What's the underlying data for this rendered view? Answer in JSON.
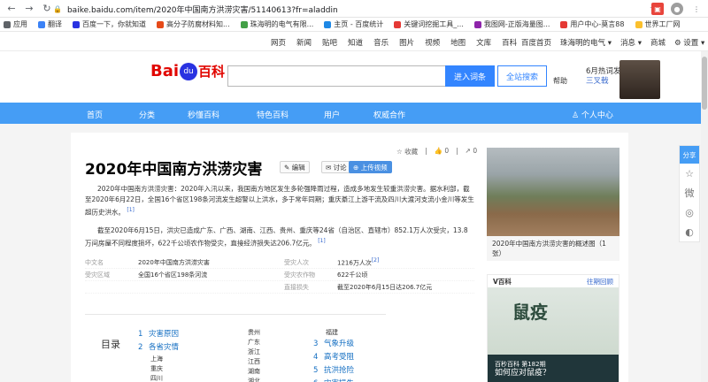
{
  "browser": {
    "url": "baike.baidu.com/item/2020年中国南方洪涝灾害/51140613?fr=aladdin",
    "back": "←",
    "forward": "→",
    "reload": "↻"
  },
  "bookmarks": [
    {
      "label": "应用",
      "color": "#5f6368"
    },
    {
      "label": "翻译",
      "color": "#3b82f6"
    },
    {
      "label": "百度一下，你就知道",
      "color": "#2932e1"
    },
    {
      "label": "高分子防腐材料知...",
      "color": "#e64a19"
    },
    {
      "label": "珠海明的电气有限...",
      "color": "#43a047"
    },
    {
      "label": "主页 - 百度统计",
      "color": "#1e88e5"
    },
    {
      "label": "关键词挖掘工具_...",
      "color": "#e53935"
    },
    {
      "label": "我图网-正版海量图...",
      "color": "#8e24aa"
    },
    {
      "label": "用户中心-莫言88",
      "color": "#e53935"
    },
    {
      "label": "世界工厂网",
      "color": "#fbc02d"
    }
  ],
  "topnav": {
    "links": [
      "网页",
      "新闻",
      "贴吧",
      "知道",
      "音乐",
      "图片",
      "视频",
      "地图",
      "文库",
      "百科"
    ],
    "right": [
      "百度首页",
      "珠海明的电气 ▾",
      "消息 ▾",
      "商城",
      "⚙ 设置 ▾"
    ]
  },
  "header": {
    "logo_bai": "Bai",
    "logo_paw": "du",
    "logo_baike": "百科",
    "search_value": "",
    "search_button": "进入词条",
    "site_search_button": "全站搜索",
    "help": "帮助",
    "promo_title": "6月热词发布",
    "promo_sub": "三叉戟"
  },
  "mainnav": {
    "items": [
      "首页",
      "分类",
      "秒懂百科",
      "特色百科",
      "用户",
      "权威合作"
    ],
    "user_center": "♙ 个人中心"
  },
  "article": {
    "title": "2020年中国南方洪涝灾害",
    "edit": "✎ 编辑",
    "discuss": "✉ 讨论",
    "upload_video": "⊕ 上传视频",
    "meta": [
      "☆ 收藏",
      "|",
      "👍 0",
      "|",
      "↗ 0"
    ],
    "p1": "2020年中国南方洪涝灾害：2020年入汛以来，我国南方地区发生多轮强降雨过程，造成多地发生较重洪涝灾害。据水利部，截至2020年6月22日，全国16个省区198条河流发生超警以上洪水，多于常年同期；重庆綦江上游干流及四川大渡河支流小金川等发生超历史洪水。",
    "p1_ref": "[1]",
    "p2": "截至2020年6月15日，洪灾已造成广东、广西、湖南、江西、贵州、重庆等24省（自治区、直辖市）852.1万人次受灾，13.8万间房屋不同程度损坏，622千公顷农作物受灾，直接经济损失达206.7亿元。",
    "p2_ref": "[1]"
  },
  "infobox": {
    "rows": [
      {
        "k1": "中文名",
        "v1": "2020年中国南方洪涝灾害",
        "k2": "受灾人次",
        "v2": "1216万人次",
        "ref": "[2]"
      },
      {
        "k1": "受灾区域",
        "v1": "全国16个省区198条河流",
        "k2": "受灾农作物",
        "v2": "622千公顷",
        "ref": ""
      },
      {
        "k1": "",
        "v1": "",
        "k2": "直接损失",
        "v2": "截至2020年6月15日达206.7亿元",
        "ref": ""
      }
    ]
  },
  "toc": {
    "title": "目录",
    "col1": [
      {
        "num": "1",
        "label": "灾害原因"
      },
      {
        "num": "2",
        "label": "各省灾情"
      }
    ],
    "col1_subs": [
      "上海",
      "重庆",
      "四川"
    ],
    "col2_subs": [
      "贵州",
      "广东",
      "浙江",
      "江西",
      "湖南",
      "湖北"
    ],
    "col3_sub": "福建",
    "col3": [
      {
        "num": "3",
        "label": "气象升级"
      },
      {
        "num": "4",
        "label": "高考受阻"
      },
      {
        "num": "5",
        "label": "抗洪抢险"
      },
      {
        "num": "6",
        "label": "灾害损失"
      }
    ]
  },
  "side": {
    "caption": "2020年中国南方洪涝灾害的概述图（1张）",
    "vbk_logo": "V百科",
    "vbk_more": "往期回顾",
    "vbk_big": "鼠疫",
    "vbk_issue": "百秒百科 第182期",
    "vbk_question": "如何应对鼠疫？"
  },
  "share": {
    "label": "分享",
    "icons": [
      "☆",
      "微",
      "◎",
      "◐"
    ]
  }
}
